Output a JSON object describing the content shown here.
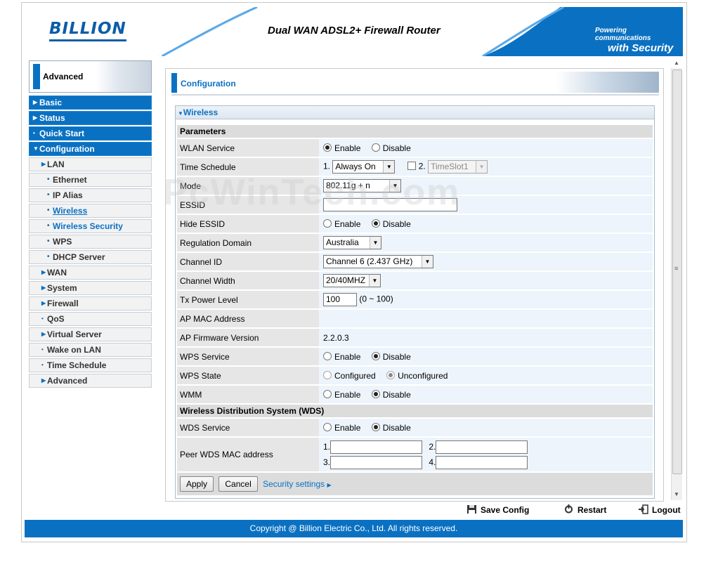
{
  "header": {
    "logo": "BILLION",
    "product_title": "Dual WAN ADSL2+ Firewall Router",
    "tagline_line1": "Powering communications",
    "tagline_line2": "with Security"
  },
  "mode": {
    "label": "Advanced"
  },
  "nav": {
    "main": [
      "Basic",
      "Status",
      "Quick Start",
      "Configuration"
    ],
    "lan": "LAN",
    "lan_items": [
      "Ethernet",
      "IP Alias",
      "Wireless",
      "Wireless Security",
      "WPS",
      "DHCP Server"
    ],
    "others": [
      "WAN",
      "System",
      "Firewall",
      "QoS",
      "Virtual Server",
      "Wake on LAN",
      "Time Schedule",
      "Advanced"
    ]
  },
  "page": {
    "title": "Configuration",
    "panel_title": "Wireless"
  },
  "form": {
    "parameters_header": "Parameters",
    "wlan_service": {
      "label": "WLAN Service",
      "enable": "Enable",
      "disable": "Disable"
    },
    "time_schedule": {
      "label": "Time Schedule",
      "num1": "1.",
      "value1": "Always On",
      "num2": "2.",
      "value2": "TimeSlot1"
    },
    "mode": {
      "label": "Mode",
      "value": "802.11g + n"
    },
    "essid": {
      "label": "ESSID",
      "value": ""
    },
    "hide_essid": {
      "label": "Hide ESSID",
      "enable": "Enable",
      "disable": "Disable"
    },
    "regulation_domain": {
      "label": "Regulation Domain",
      "value": "Australia"
    },
    "channel_id": {
      "label": "Channel ID",
      "value": "Channel 6 (2.437 GHz)"
    },
    "channel_width": {
      "label": "Channel Width",
      "value": "20/40MHZ"
    },
    "tx_power": {
      "label": "Tx Power Level",
      "value": "100",
      "range": "(0 ~ 100)"
    },
    "ap_mac": {
      "label": "AP MAC Address",
      "value": ""
    },
    "ap_firmware": {
      "label": "AP Firmware Version",
      "value": "2.2.0.3"
    },
    "wps_service": {
      "label": "WPS Service",
      "enable": "Enable",
      "disable": "Disable"
    },
    "wps_state": {
      "label": "WPS State",
      "configured": "Configured",
      "unconfigured": "Unconfigured"
    },
    "wmm": {
      "label": "WMM",
      "enable": "Enable",
      "disable": "Disable"
    },
    "wds_header": "Wireless Distribution System (WDS)",
    "wds_service": {
      "label": "WDS Service",
      "enable": "Enable",
      "disable": "Disable"
    },
    "peer_wds": {
      "label": "Peer WDS MAC address",
      "n1": "1.",
      "n2": "2.",
      "n3": "3.",
      "n4": "4."
    }
  },
  "buttons": {
    "apply": "Apply",
    "cancel": "Cancel",
    "security_link": "Security settings"
  },
  "bottom": {
    "save": "Save Config",
    "restart": "Restart",
    "logout": "Logout"
  },
  "footer": "Copyright @ Billion Electric Co., Ltd. All rights reserved.",
  "watermark": "PcWinTech.com",
  "colors": {
    "brand_blue": "#0a71c2",
    "label_bg": "#e6e6e6",
    "value_bg": "#edf4fb"
  }
}
